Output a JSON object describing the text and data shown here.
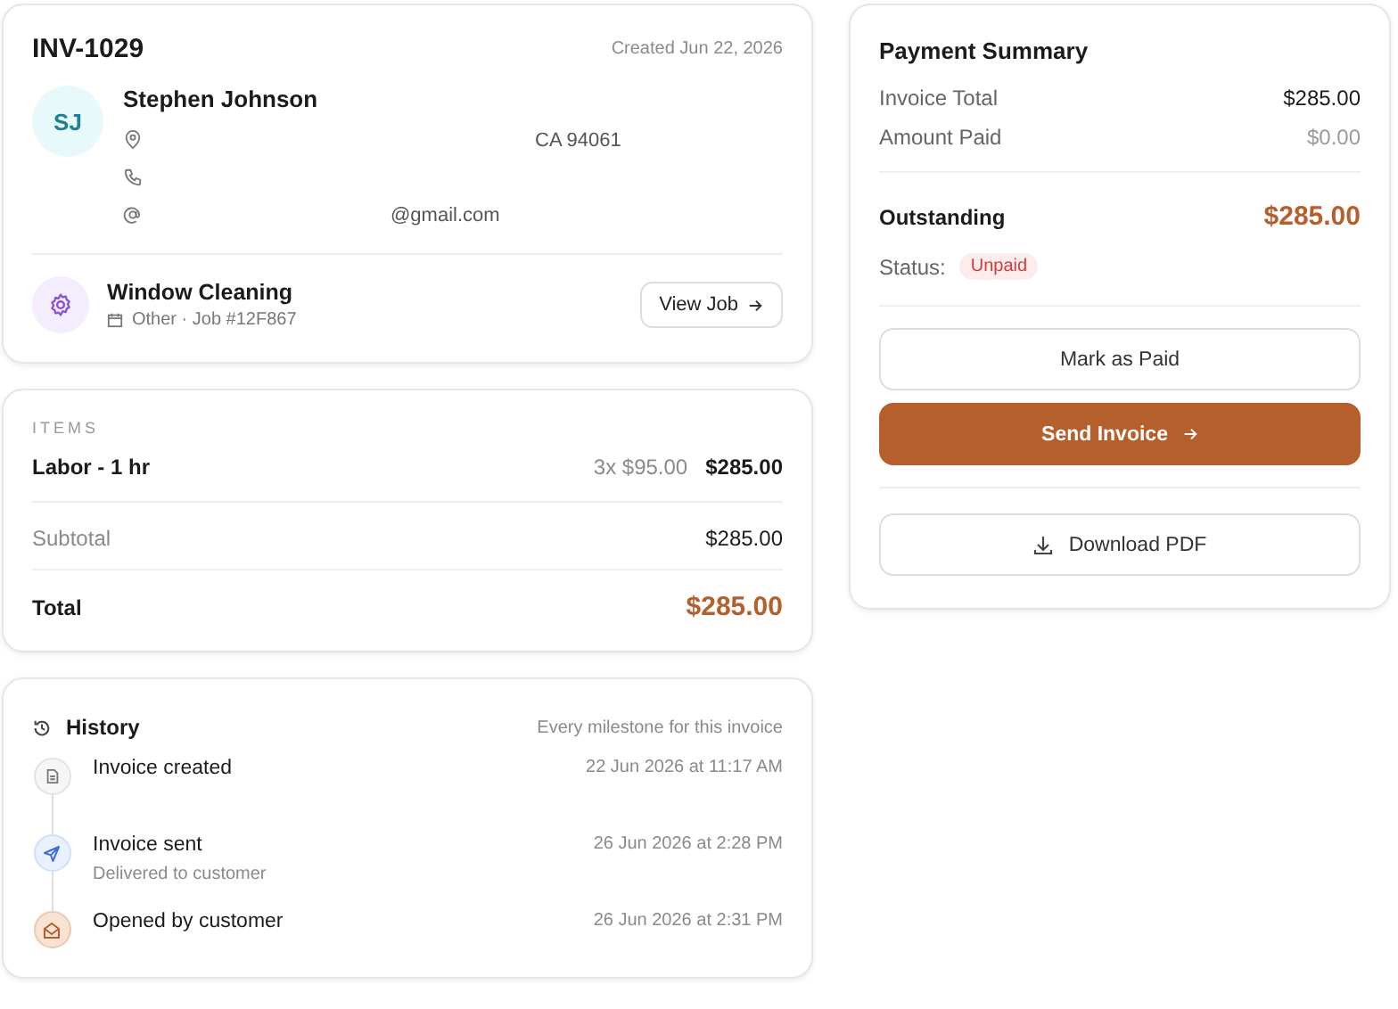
{
  "invoice": {
    "number": "INV-1029",
    "created": "Created Jun 22, 2026",
    "customer": {
      "initials": "SJ",
      "name": "Stephen Johnson",
      "contacts": [
        {
          "kind": "address",
          "text": "CA 94061"
        },
        {
          "kind": "phone"
        },
        {
          "kind": "email",
          "text": "@gmail.com"
        }
      ]
    },
    "job": {
      "title": "Window Cleaning",
      "meta": "Other · Job #12F867",
      "button": "View Job"
    }
  },
  "items": {
    "heading": "ITEMS",
    "lines": [
      {
        "name": "Labor - 1 hr",
        "qty_price": "3x $95.00",
        "amount": "$285.00"
      }
    ],
    "subtotal": {
      "label": "Subtotal",
      "value": "$285.00"
    },
    "total": {
      "label": "Total",
      "value": "$285.00"
    }
  },
  "history": {
    "title": "History",
    "subtitle": "Every milestone for this invoice",
    "events": [
      {
        "kind": "document",
        "title": "Invoice created",
        "time": "22 Jun 2026 at 11:17 AM"
      },
      {
        "kind": "sent",
        "title": "Invoice sent",
        "detail": "Delivered to customer",
        "time": "26 Jun 2026 at 2:28 PM"
      },
      {
        "kind": "opened",
        "title": "Opened by customer",
        "time": "26 Jun 2026 at 2:31 PM"
      }
    ]
  },
  "payment_summary": {
    "title": "Payment Summary",
    "rows": [
      {
        "label": "Invoice Total",
        "value": "$285.00",
        "muted": false
      },
      {
        "label": "Amount Paid",
        "value": "$0.00",
        "muted": true
      }
    ],
    "outstanding": {
      "label": "Outstanding",
      "value": "$285.00"
    },
    "status": {
      "label": "Status:",
      "value": "Unpaid"
    },
    "buttons": [
      {
        "kind": "outline",
        "label": "Mark as Paid"
      },
      {
        "kind": "primary",
        "label": "Send Invoice"
      },
      {
        "kind": "download",
        "label": "Download PDF"
      }
    ]
  }
}
